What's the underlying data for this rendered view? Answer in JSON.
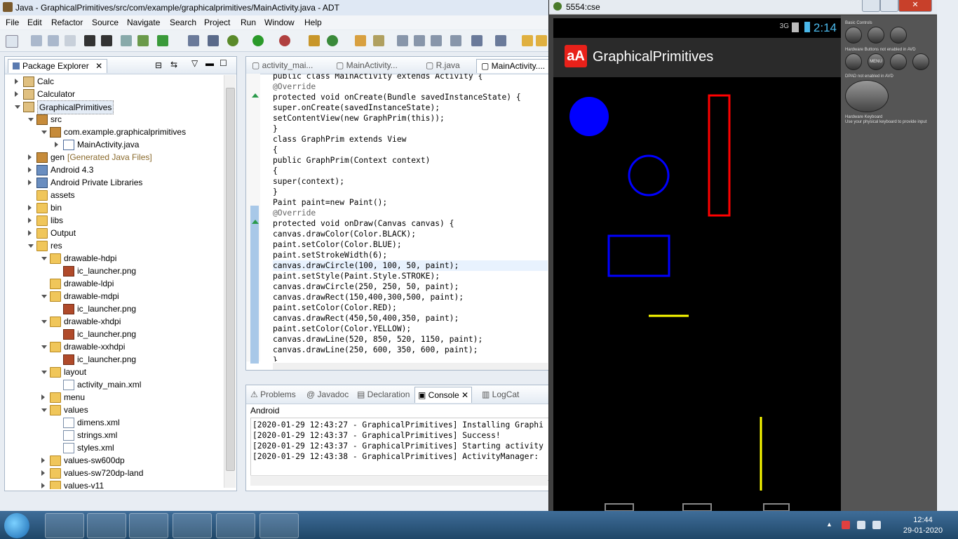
{
  "eclipse": {
    "title": "Java - GraphicalPrimitives/src/com/example/graphicalprimitives/MainActivity.java - ADT",
    "menus": [
      "File",
      "Edit",
      "Refactor",
      "Source",
      "Navigate",
      "Search",
      "Project",
      "Run",
      "Window",
      "Help"
    ]
  },
  "package_explorer": {
    "title": "Package Explorer",
    "items": [
      {
        "label": "Calc",
        "depth": 0,
        "type": "proj",
        "toggle": "c"
      },
      {
        "label": "Calculator",
        "depth": 0,
        "type": "proj",
        "toggle": "c"
      },
      {
        "label": "GraphicalPrimitives",
        "depth": 0,
        "type": "proj",
        "toggle": "e",
        "selected": true
      },
      {
        "label": "src",
        "depth": 1,
        "type": "pkg",
        "toggle": "e"
      },
      {
        "label": "com.example.graphicalprimitives",
        "depth": 2,
        "type": "pkg",
        "toggle": "e"
      },
      {
        "label": "MainActivity.java",
        "depth": 3,
        "type": "java",
        "toggle": "c"
      },
      {
        "label": "gen",
        "suffix": "[Generated Java Files]",
        "depth": 1,
        "type": "pkg",
        "toggle": "c"
      },
      {
        "label": "Android 4.3",
        "depth": 1,
        "type": "lib",
        "toggle": "c"
      },
      {
        "label": "Android Private Libraries",
        "depth": 1,
        "type": "lib",
        "toggle": "c"
      },
      {
        "label": "assets",
        "depth": 1,
        "type": "folder",
        "toggle": ""
      },
      {
        "label": "bin",
        "depth": 1,
        "type": "folder",
        "toggle": "c"
      },
      {
        "label": "libs",
        "depth": 1,
        "type": "folder",
        "toggle": "c"
      },
      {
        "label": "Output",
        "depth": 1,
        "type": "folder",
        "toggle": "c"
      },
      {
        "label": "res",
        "depth": 1,
        "type": "folder",
        "toggle": "e"
      },
      {
        "label": "drawable-hdpi",
        "depth": 2,
        "type": "folder",
        "toggle": "e"
      },
      {
        "label": "ic_launcher.png",
        "depth": 3,
        "type": "png",
        "toggle": ""
      },
      {
        "label": "drawable-ldpi",
        "depth": 2,
        "type": "folder",
        "toggle": ""
      },
      {
        "label": "drawable-mdpi",
        "depth": 2,
        "type": "folder",
        "toggle": "e"
      },
      {
        "label": "ic_launcher.png",
        "depth": 3,
        "type": "png",
        "toggle": ""
      },
      {
        "label": "drawable-xhdpi",
        "depth": 2,
        "type": "folder",
        "toggle": "e"
      },
      {
        "label": "ic_launcher.png",
        "depth": 3,
        "type": "png",
        "toggle": ""
      },
      {
        "label": "drawable-xxhdpi",
        "depth": 2,
        "type": "folder",
        "toggle": "e"
      },
      {
        "label": "ic_launcher.png",
        "depth": 3,
        "type": "png",
        "toggle": ""
      },
      {
        "label": "layout",
        "depth": 2,
        "type": "folder",
        "toggle": "e"
      },
      {
        "label": "activity_main.xml",
        "depth": 3,
        "type": "xml",
        "toggle": ""
      },
      {
        "label": "menu",
        "depth": 2,
        "type": "folder",
        "toggle": "c"
      },
      {
        "label": "values",
        "depth": 2,
        "type": "folder",
        "toggle": "e"
      },
      {
        "label": "dimens.xml",
        "depth": 3,
        "type": "xml",
        "toggle": ""
      },
      {
        "label": "strings.xml",
        "depth": 3,
        "type": "xml",
        "toggle": ""
      },
      {
        "label": "styles.xml",
        "depth": 3,
        "type": "xml",
        "toggle": ""
      },
      {
        "label": "values-sw600dp",
        "depth": 2,
        "type": "folder",
        "toggle": "c"
      },
      {
        "label": "values-sw720dp-land",
        "depth": 2,
        "type": "folder",
        "toggle": "c"
      },
      {
        "label": "values-v11",
        "depth": 2,
        "type": "folder",
        "toggle": "c"
      }
    ]
  },
  "editor": {
    "tabs": [
      "activity_mai...",
      "MainActivity...",
      "R.java",
      "MainActivity...."
    ],
    "code": [
      {
        "k": "",
        "t": "public class MainActivity extends Activity {"
      },
      {
        "k": "an",
        "t": "@Override"
      },
      {
        "k": "",
        "t": "protected void onCreate(Bundle savedInstanceState) {"
      },
      {
        "k": "",
        "t": "super.onCreate(savedInstanceState);"
      },
      {
        "k": "",
        "t": "setContentView(new GraphPrim(this));"
      },
      {
        "k": "",
        "t": "}"
      },
      {
        "k": "",
        "t": "class GraphPrim extends View"
      },
      {
        "k": "",
        "t": "{"
      },
      {
        "k": "",
        "t": "public GraphPrim(Context context)"
      },
      {
        "k": "",
        "t": "{"
      },
      {
        "k": "",
        "t": "super(context);"
      },
      {
        "k": "",
        "t": "}"
      },
      {
        "k": "",
        "t": "Paint paint=new Paint();"
      },
      {
        "k": "an",
        "t": "@Override"
      },
      {
        "k": "",
        "t": "protected void onDraw(Canvas canvas) {"
      },
      {
        "k": "",
        "t": "canvas.drawColor(Color.BLACK);"
      },
      {
        "k": "",
        "t": "paint.setColor(Color.BLUE);"
      },
      {
        "k": "",
        "t": "paint.setStrokeWidth(6);"
      },
      {
        "k": "hl",
        "t": "canvas.drawCircle(100, 100, 50, paint);"
      },
      {
        "k": "",
        "t": "paint.setStyle(Paint.Style.STROKE);"
      },
      {
        "k": "",
        "t": "canvas.drawCircle(250, 250, 50, paint);"
      },
      {
        "k": "",
        "t": "canvas.drawRect(150,400,300,500, paint);"
      },
      {
        "k": "",
        "t": "paint.setColor(Color.RED);"
      },
      {
        "k": "",
        "t": "canvas.drawRect(450,50,400,350, paint);"
      },
      {
        "k": "",
        "t": "paint.setColor(Color.YELLOW);"
      },
      {
        "k": "",
        "t": "canvas.drawLine(520, 850, 520, 1150, paint);"
      },
      {
        "k": "",
        "t": "canvas.drawLine(250, 600, 350, 600, paint);"
      },
      {
        "k": "",
        "t": "}"
      }
    ]
  },
  "console": {
    "tabs": [
      "Problems",
      "Javadoc",
      "Declaration",
      "Console",
      "LogCat"
    ],
    "active_tab": "Console",
    "label": "Android",
    "lines": [
      "[2020-01-29 12:43:27 - GraphicalPrimitives] Installing Graphi",
      "[2020-01-29 12:43:37 - GraphicalPrimitives] Success!",
      "[2020-01-29 12:43:37 - GraphicalPrimitives] Starting activity",
      "[2020-01-29 12:43:38 - GraphicalPrimitives] ActivityManager:"
    ]
  },
  "emulator": {
    "title": "5554:cse",
    "status_time": "2:14",
    "network": "3G",
    "app_icon_text": "aA",
    "app_title": "GraphicalPrimitives",
    "controls": {
      "basic": "Basic Controls",
      "hw_buttons": "Hardware Buttons not enabled in AVD",
      "menu_label": "MENU",
      "dpad": "DPAD not enabled in AVD",
      "keyboard": "Hardware Keyboard",
      "keyboard_hint": "Use your physical keyboard to provide input"
    },
    "colors": {
      "blue": "#0000ff",
      "red": "#ff0000",
      "yellow": "#ffff00",
      "black": "#000000"
    }
  },
  "taskbar": {
    "time": "12:44",
    "date": "29-01-2020"
  }
}
